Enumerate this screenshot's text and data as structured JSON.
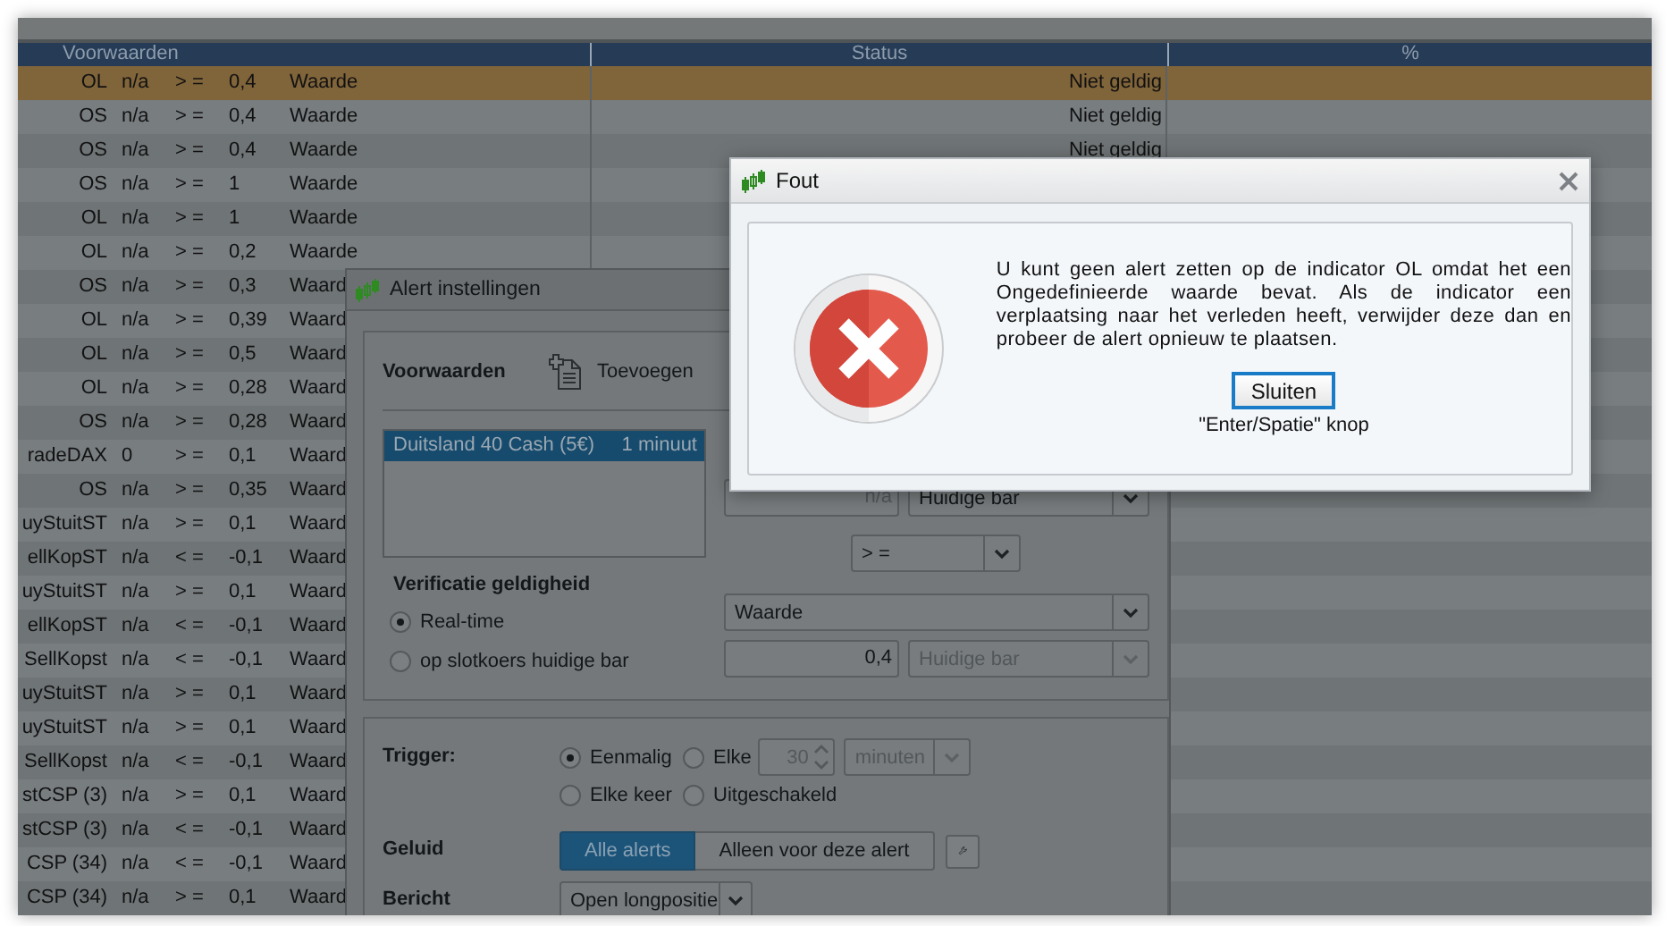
{
  "table": {
    "columns": [
      "Voorwaarden",
      "Status",
      "%"
    ],
    "rows": [
      {
        "name": "OL",
        "shift": "n/a",
        "operator": "> =",
        "value": "0,4",
        "type": "Waarde",
        "status": "Niet geldig",
        "selected": true
      },
      {
        "name": "OS",
        "shift": "n/a",
        "operator": "> =",
        "value": "0,4",
        "type": "Waarde",
        "status": "Niet geldig",
        "selected": false
      },
      {
        "name": "OS",
        "shift": "n/a",
        "operator": "> =",
        "value": "0,4",
        "type": "Waarde",
        "status": "Niet geldig",
        "selected": false
      },
      {
        "name": "OS",
        "shift": "n/a",
        "operator": "> =",
        "value": "1",
        "type": "Waarde",
        "selected": false
      },
      {
        "name": "OL",
        "shift": "n/a",
        "operator": "> =",
        "value": "1",
        "type": "Waarde",
        "selected": false
      },
      {
        "name": "OL",
        "shift": "n/a",
        "operator": "> =",
        "value": "0,2",
        "type": "Waarde",
        "selected": false
      },
      {
        "name": "OS",
        "shift": "n/a",
        "operator": "> =",
        "value": "0,3",
        "type": "Waard",
        "selected": false
      },
      {
        "name": "OL",
        "shift": "n/a",
        "operator": "> =",
        "value": "0,39",
        "type": "Waard",
        "selected": false
      },
      {
        "name": "OL",
        "shift": "n/a",
        "operator": "> =",
        "value": "0,5",
        "type": "Waard",
        "selected": false
      },
      {
        "name": "OL",
        "shift": "n/a",
        "operator": "> =",
        "value": "0,28",
        "type": "Waard",
        "selected": false
      },
      {
        "name": "OS",
        "shift": "n/a",
        "operator": "> =",
        "value": "0,28",
        "type": "Waard",
        "selected": false
      },
      {
        "name": "radeDAX",
        "shift": "0",
        "operator": "> =",
        "value": "0,1",
        "type": "Waard",
        "selected": false
      },
      {
        "name": "OS",
        "shift": "n/a",
        "operator": "> =",
        "value": "0,35",
        "type": "Waard",
        "selected": false
      },
      {
        "name": "uyStuitST",
        "shift": "n/a",
        "operator": "> =",
        "value": "0,1",
        "type": "Waard",
        "selected": false
      },
      {
        "name": "ellKopST",
        "shift": "n/a",
        "operator": "< =",
        "value": "-0,1",
        "type": "Waard",
        "selected": false
      },
      {
        "name": "uyStuitST",
        "shift": "n/a",
        "operator": "> =",
        "value": "0,1",
        "type": "Waard",
        "selected": false
      },
      {
        "name": "ellKopST",
        "shift": "n/a",
        "operator": "< =",
        "value": "-0,1",
        "type": "Waard",
        "selected": false
      },
      {
        "name": "SellKopst",
        "shift": "n/a",
        "operator": "< =",
        "value": "-0,1",
        "type": "Waard",
        "selected": false
      },
      {
        "name": "uyStuitST",
        "shift": "n/a",
        "operator": "> =",
        "value": "0,1",
        "type": "Waard",
        "selected": false
      },
      {
        "name": "uyStuitST",
        "shift": "n/a",
        "operator": "> =",
        "value": "0,1",
        "type": "Waard",
        "selected": false
      },
      {
        "name": "SellKopst",
        "shift": "n/a",
        "operator": "< =",
        "value": "-0,1",
        "type": "Waard",
        "selected": false
      },
      {
        "name": "stCSP (3)",
        "shift": "n/a",
        "operator": "> =",
        "value": "0,1",
        "type": "Waard",
        "selected": false
      },
      {
        "name": "stCSP (3)",
        "shift": "n/a",
        "operator": "< =",
        "value": "-0,1",
        "type": "Waard",
        "selected": false
      },
      {
        "name": "CSP (34)",
        "shift": "n/a",
        "operator": "< =",
        "value": "-0,1",
        "type": "Waard",
        "selected": false
      },
      {
        "name": "CSP (34)",
        "shift": "n/a",
        "operator": "> =",
        "value": "0,1",
        "type": "Waard",
        "selected": false
      }
    ]
  },
  "alert_dialog": {
    "title": "Alert instellingen",
    "conditions": {
      "heading": "Voorwaarden",
      "add_label": "Toevoegen",
      "list": [
        {
          "name": "Duitsland 40 Cash (5€)",
          "interval": "1 minuut",
          "selected": true
        }
      ],
      "offset": "n/a",
      "bar": "Huidige bar",
      "operator": "> =",
      "validity": {
        "heading": "Verificatie geldigheid",
        "options": [
          {
            "label": "Real-time",
            "selected": true
          },
          {
            "label": "op slotkoers huidige bar",
            "selected": false
          }
        ]
      },
      "compare": "Waarde",
      "threshold": "0,4",
      "threshold_bar": {
        "value": "Huidige bar",
        "disabled": true
      }
    },
    "trigger": {
      "label": "Trigger:",
      "options": [
        {
          "label": "Eenmalig",
          "selected": true
        },
        {
          "label": "Elke",
          "selected": false
        },
        {
          "label": "Elke keer",
          "selected": false
        },
        {
          "label": "Uitgeschakeld",
          "selected": false
        }
      ],
      "every_count": "30",
      "every_unit": "minuten",
      "every_disabled": true
    },
    "sound": {
      "label": "Geluid",
      "options": [
        {
          "label": "Alle alerts",
          "selected": true
        },
        {
          "label": "Alleen voor deze alert",
          "selected": false
        }
      ]
    },
    "message": {
      "label": "Bericht",
      "value": "Open longpositie"
    }
  },
  "error_dialog": {
    "title": "Fout",
    "message": "U kunt geen alert zetten op de indicator OL omdat het een Ongedefinieerde waarde bevat. Als de indicator een verplaatsing naar het verleden heeft, verwijder deze dan en probeer de alert opnieuw te plaatsen.",
    "button": "Sluiten",
    "hint": "\"Enter/Spatie\" knop"
  }
}
